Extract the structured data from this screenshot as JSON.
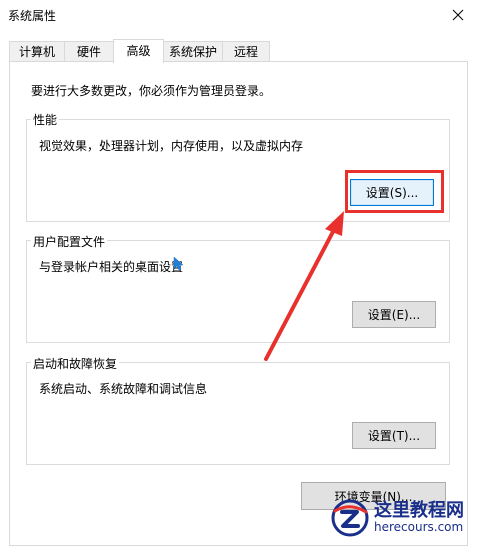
{
  "window": {
    "title": "系统属性"
  },
  "tabs": [
    {
      "label": "计算机名"
    },
    {
      "label": "硬件"
    },
    {
      "label": "高级",
      "active": true
    },
    {
      "label": "系统保护"
    },
    {
      "label": "远程"
    }
  ],
  "advanced": {
    "admin_note": "要进行大多数更改，你必须作为管理员登录。",
    "performance": {
      "title": "性能",
      "desc": "视觉效果，处理器计划，内存使用，以及虚拟内存",
      "button": "设置(S)..."
    },
    "user_profiles": {
      "title": "用户配置文件",
      "desc": "与登录帐户相关的桌面设置",
      "button": "设置(E)..."
    },
    "startup_recovery": {
      "title": "启动和故障恢复",
      "desc": "系统启动、系统故障和调试信息",
      "button": "设置(T)..."
    },
    "env_button": "环境变量(N)..."
  },
  "annotation": {
    "color": "#e8312d"
  },
  "watermark": {
    "main": "这里教程网",
    "sub": "herecours.com",
    "color": "#1a2f8a"
  }
}
